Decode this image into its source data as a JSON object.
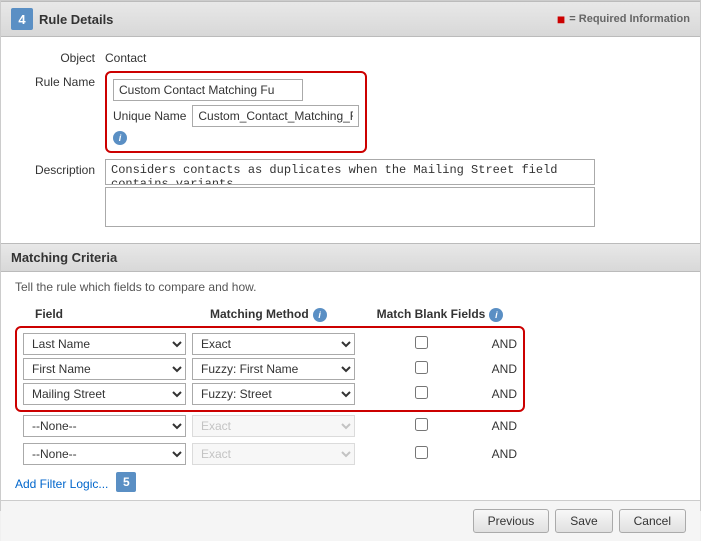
{
  "page": {
    "title": "Rule Details",
    "step4_label": "4",
    "step5_label": "5",
    "required_info_label": "= Required Information",
    "object_label": "Object",
    "object_value": "Contact",
    "rule_name_label": "Rule Name",
    "rule_name_value": "Custom Contact Matching Fu",
    "unique_name_label": "Unique Name",
    "unique_name_value": "Custom_Contact_Matching_F",
    "description_label": "Description",
    "description_value": "Considers contacts as duplicates when the Mailing Street field contains variants.",
    "matching_criteria_title": "Matching Criteria",
    "matching_criteria_desc": "Tell the rule which fields to compare and how.",
    "col_field_label": "Field",
    "col_method_label": "Matching Method",
    "col_blank_label": "Match Blank Fields",
    "col_and_label": "AND",
    "rows": [
      {
        "field": "Last Name",
        "method": "Exact",
        "blank": false,
        "and": "AND",
        "highlighted": true,
        "method_disabled": false
      },
      {
        "field": "First Name",
        "method": "Fuzzy: First Name",
        "blank": false,
        "and": "AND",
        "highlighted": true,
        "method_disabled": false
      },
      {
        "field": "Mailing Street",
        "method": "Fuzzy: Street",
        "blank": false,
        "and": "AND",
        "highlighted": true,
        "method_disabled": false
      },
      {
        "field": "--None--",
        "method": "Exact",
        "blank": false,
        "and": "AND",
        "highlighted": false,
        "method_disabled": true
      },
      {
        "field": "--None--",
        "method": "Exact",
        "blank": false,
        "and": "AND",
        "highlighted": false,
        "method_disabled": true
      }
    ],
    "add_filter_label": "Add Filter Logic...",
    "btn_previous": "Previous",
    "btn_save": "Save",
    "btn_cancel": "Cancel"
  }
}
